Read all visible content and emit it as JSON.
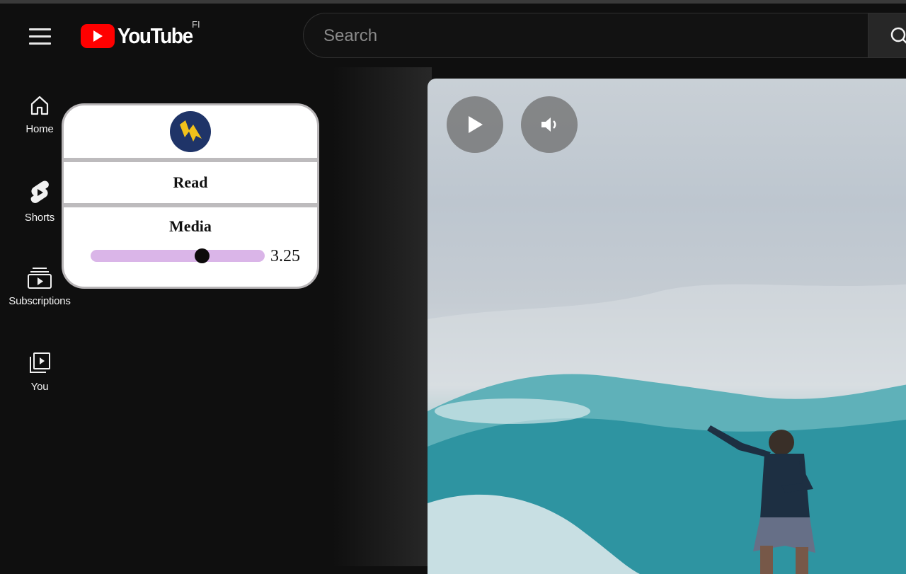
{
  "header": {
    "logo_text": "YouTube",
    "region": "FI",
    "search_placeholder": "Search",
    "search_value": ""
  },
  "sidebar": {
    "items": [
      {
        "label": "Home",
        "icon": "home-icon"
      },
      {
        "label": "Shorts",
        "icon": "shorts-icon"
      },
      {
        "label": "Subscriptions",
        "icon": "subscriptions-icon"
      },
      {
        "label": "You",
        "icon": "you-icon"
      }
    ]
  },
  "video": {
    "controls": [
      "play-icon",
      "volume-icon"
    ]
  },
  "popup": {
    "logo_icon": "lightning-bolt-icon",
    "read_label": "Read",
    "media_label": "Media",
    "speed_value": "3.25",
    "slider_fraction": 0.64
  },
  "colors": {
    "background": "#0f0f0f",
    "youtube_red": "#ff0000",
    "slider_track": "#dab5e8",
    "popup_logo_bg": "#1f3468",
    "popup_logo_bolt": "#f2c21b"
  }
}
